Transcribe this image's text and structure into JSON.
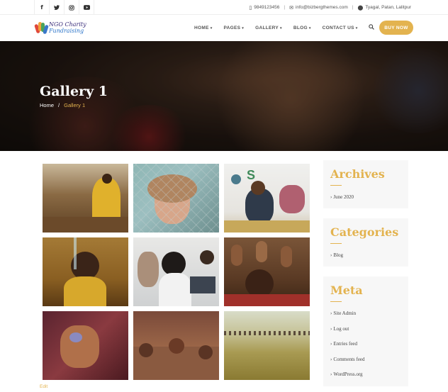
{
  "topbar": {
    "social": [
      {
        "icon": "facebook-icon",
        "glyph": "f"
      },
      {
        "icon": "twitter-icon",
        "glyph": "t"
      },
      {
        "icon": "instagram-icon",
        "glyph": "◎"
      },
      {
        "icon": "youtube-icon",
        "glyph": "▶"
      }
    ],
    "phone": "9849123456",
    "email": "info@bizbergthemes.com",
    "address": "Tyagal, Patan, Lalitpur"
  },
  "header": {
    "logo_line1": "NGO Charity",
    "logo_line2": "Fundraising",
    "nav": [
      {
        "label": "HOME"
      },
      {
        "label": "PAGES"
      },
      {
        "label": "GALLERY"
      },
      {
        "label": "BLOG"
      },
      {
        "label": "CONTACT US"
      }
    ],
    "buy_label": "BUY NOW"
  },
  "hero": {
    "title": "Gallery 1",
    "crumb_home": "Home",
    "crumb_sep": "/",
    "crumb_current": "Gallery 1"
  },
  "gallery": {
    "items": [
      "photo-man-yellow-cloth",
      "photo-girl-behind-fence",
      "photo-children-drawing",
      "photo-boy-water-splash",
      "photo-woman-laptop",
      "photo-children-raising-hands",
      "photo-henna-hands",
      "photo-children-on-wall",
      "photo-field-crowd"
    ]
  },
  "edit_label": "Edit",
  "sidebar": {
    "archives_title": "Archives",
    "archives_items": [
      "June 2020"
    ],
    "categories_title": "Categories",
    "categories_items": [
      "Blog"
    ],
    "meta_title": "Meta",
    "meta_items": [
      "Site Admin",
      "Log out",
      "Entries feed",
      "Comments feed",
      "WordPress.org"
    ]
  },
  "colors": {
    "accent": "#e3b34f",
    "widget_bg": "#f7f7f7"
  }
}
